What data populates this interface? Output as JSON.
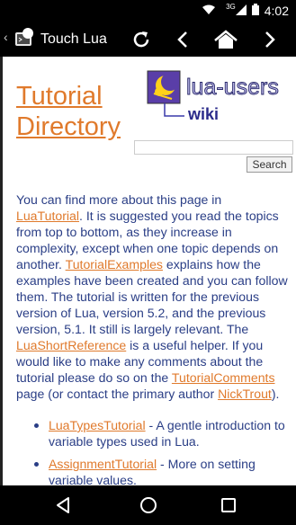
{
  "status_bar": {
    "network": "3G",
    "time": "4:02"
  },
  "action_bar": {
    "title": "Touch Lua"
  },
  "page": {
    "title_line1": "Tutorial",
    "title_line2": "Directory",
    "logo_text": "lua-users",
    "logo_sub": "wiki",
    "search_button": "Search",
    "para": {
      "t1": "You can find more about this page in ",
      "l1": "LuaTutorial",
      "t2": ". It is suggested you read the topics from top to bottom, as they increase in complexity, except when one topic depends on another. ",
      "l2": "TutorialExamples",
      "t3": " explains how the examples have been created and you can follow them. The tutorial is written for the previous version of Lua, version 5.2, and the previous version, 5.1. It still is largely relevant. The ",
      "l3": "LuaShortReference",
      "t4": " is a useful helper. If you would like to make any comments about the tutorial please do so on the ",
      "l4": "TutorialComments",
      "t5": " page (or contact the primary author ",
      "l5": "NickTrout",
      "t6": ")."
    },
    "list": [
      {
        "link": "LuaTypesTutorial",
        "text": " - A gentle introduction to variable types used in Lua."
      },
      {
        "link": "AssignmentTutorial",
        "text": " - More on setting variable values."
      }
    ]
  },
  "colors": {
    "link": "#e07a2c",
    "body_text": "#2a3e86",
    "bar_bg": "#000000"
  },
  "icons": [
    "wifi-icon",
    "signal-icon",
    "battery-icon",
    "refresh-icon",
    "chevron-left-icon",
    "home-icon",
    "chevron-right-icon",
    "nav-back-icon",
    "nav-home-icon",
    "nav-recents-icon"
  ]
}
